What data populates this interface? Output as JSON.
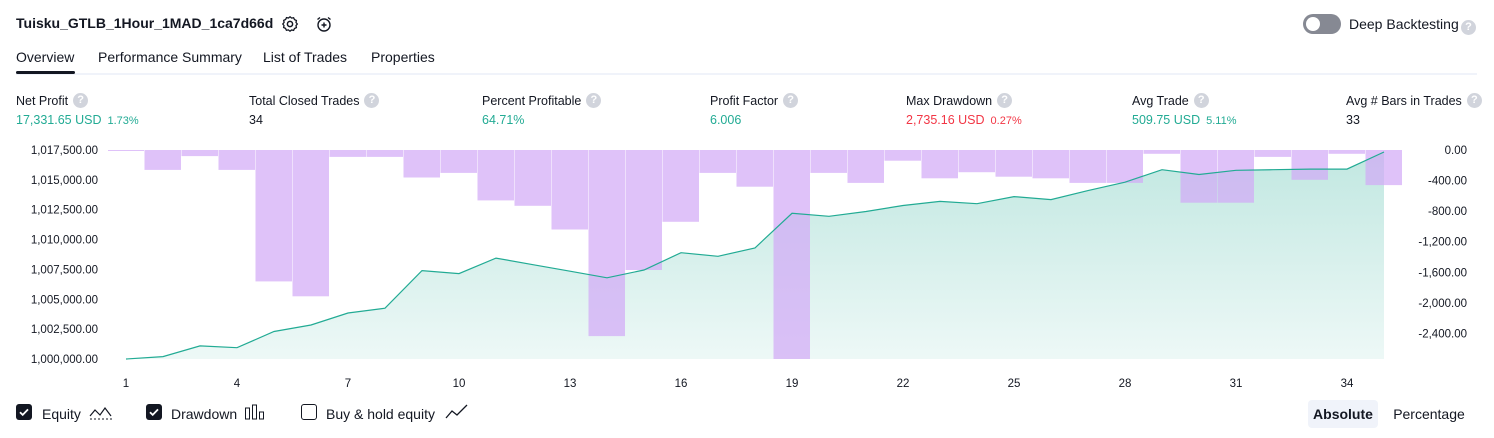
{
  "header": {
    "title": "Tuisku_GTLB_1Hour_1MAD_1ca7d66d",
    "settings_icon": "gear-icon",
    "add_alert_icon": "alarm-add-icon",
    "deep_backtesting_label": "Deep Backtesting",
    "deep_backtesting_enabled": false,
    "help_glyph": "?"
  },
  "tabs": [
    {
      "label": "Overview",
      "active": true
    },
    {
      "label": "Performance Summary",
      "active": false
    },
    {
      "label": "List of Trades",
      "active": false
    },
    {
      "label": "Properties",
      "active": false
    }
  ],
  "metrics": [
    {
      "label": "Net Profit",
      "value": "17,331.65 USD",
      "pct": "1.73%",
      "color": "green"
    },
    {
      "label": "Total Closed Trades",
      "value": "34",
      "pct": "",
      "color": "dark"
    },
    {
      "label": "Percent Profitable",
      "value": "64.71%",
      "pct": "",
      "color": "green"
    },
    {
      "label": "Profit Factor",
      "value": "6.006",
      "pct": "",
      "color": "green"
    },
    {
      "label": "Max Drawdown",
      "value": "2,735.16 USD",
      "pct": "0.27%",
      "color": "red"
    },
    {
      "label": "Avg Trade",
      "value": "509.75 USD",
      "pct": "5.11%",
      "color": "green"
    },
    {
      "label": "Avg # Bars in Trades",
      "value": "33",
      "pct": "",
      "color": "dark"
    }
  ],
  "chart_data": {
    "type": "area",
    "colors": {
      "equity_line": "#22ab94",
      "equity_fill": "#22ab94",
      "drawdown": "#d1a8f7",
      "overlap": "#b8a9ec"
    },
    "left_axis": {
      "ticks": [
        "1,017,500.00",
        "1,015,000.00",
        "1,012,500.00",
        "1,010,000.00",
        "1,007,500.00",
        "1,005,000.00",
        "1,002,500.00",
        "1,000,000.00"
      ],
      "ylim": [
        1000000,
        1017500
      ]
    },
    "right_axis": {
      "ticks": [
        "0.00",
        "-400.00",
        "-800.00",
        "-1,200.00",
        "-1,600.00",
        "-2,000.00",
        "-2,400.00"
      ],
      "ylim": [
        -2735.16,
        0
      ]
    },
    "x_ticks": [
      "1",
      "4",
      "7",
      "10",
      "13",
      "16",
      "19",
      "22",
      "25",
      "28",
      "31",
      "34"
    ],
    "series": [
      {
        "name": "Equity",
        "x": [
          1,
          2,
          3,
          4,
          5,
          6,
          7,
          8,
          9,
          10,
          11,
          12,
          13,
          14,
          15,
          16,
          17,
          18,
          19,
          20,
          21,
          22,
          23,
          24,
          25,
          26,
          27,
          28,
          29,
          30,
          31,
          32,
          33,
          34,
          35
        ],
        "values": [
          1000000,
          1000200,
          1001100,
          1000950,
          1002300,
          1002850,
          1003850,
          1004250,
          1007400,
          1007150,
          1008450,
          1007900,
          1007350,
          1006800,
          1007450,
          1008900,
          1008600,
          1009300,
          1012200,
          1011950,
          1012350,
          1012850,
          1013200,
          1013000,
          1013600,
          1013350,
          1014100,
          1014800,
          1015850,
          1015450,
          1015800,
          1015850,
          1015900,
          1015900,
          1017331.65
        ]
      },
      {
        "name": "Drawdown",
        "x": [
          1,
          2,
          3,
          4,
          5,
          6,
          7,
          8,
          9,
          10,
          11,
          12,
          13,
          14,
          15,
          16,
          17,
          18,
          19,
          20,
          21,
          22,
          23,
          24,
          25,
          26,
          27,
          28,
          29,
          30,
          31,
          32,
          33,
          34,
          35
        ],
        "values": [
          -10,
          -260,
          -80,
          -260,
          -1720,
          -1915,
          -90,
          -90,
          -360,
          -300,
          -660,
          -730,
          -1040,
          -2435,
          -1570,
          -940,
          -300,
          -480,
          -2735.16,
          -300,
          -430,
          -140,
          -370,
          -290,
          -350,
          -370,
          -430,
          -430,
          -50,
          -690,
          -690,
          -90,
          -390,
          -50,
          -460
        ]
      }
    ]
  },
  "legend": [
    {
      "label": "Equity",
      "checked": true,
      "icon": "area-line-icon"
    },
    {
      "label": "Drawdown",
      "checked": true,
      "icon": "bars-icon"
    },
    {
      "label": "Buy & hold equity",
      "checked": false,
      "icon": "line-icon"
    }
  ],
  "toggle_buttons": {
    "absolute": "Absolute",
    "percentage": "Percentage",
    "selected": "absolute"
  }
}
